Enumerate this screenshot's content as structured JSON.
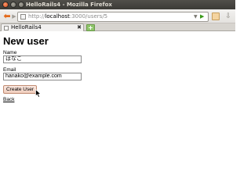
{
  "window": {
    "title": "HelloRails4 - Mozilla Firefox"
  },
  "navbar": {
    "url_prefix": "http://",
    "url_host": "localhost",
    "url_path": ":3000/users/5",
    "back_icon": "arrow-left-icon",
    "forward_icon": "arrow-right-icon"
  },
  "tabs": [
    {
      "label": "HelloRails4",
      "active": true
    }
  ],
  "page": {
    "title": "New user",
    "name_label": "Name",
    "name_value": "はなこ",
    "email_label": "Email",
    "email_value": "hanako@example.com",
    "submit_label": "Create User",
    "back_link": "Back"
  },
  "colors": {
    "accent_back": "#e46a1a",
    "go_green": "#3a9a19",
    "button_bg": "#f0cdbd",
    "titlebar": "#3c3b37"
  }
}
